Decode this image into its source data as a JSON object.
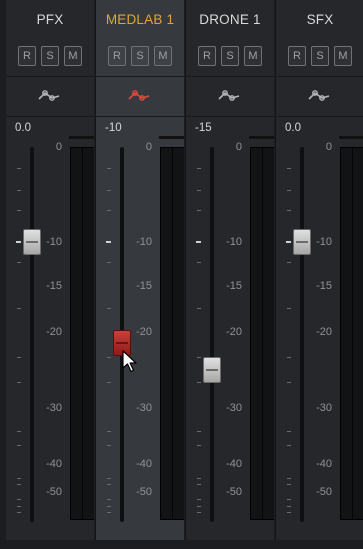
{
  "mixer": {
    "channels": [
      {
        "name": "PFX",
        "value": "0.0",
        "selected": false,
        "fader_db": -10,
        "knob": "gray",
        "eq_color": "#b4b6ba",
        "rsm": {
          "r": "R",
          "s": "S",
          "m": "M"
        }
      },
      {
        "name": "MEDLAB 1",
        "value": "-10",
        "selected": true,
        "fader_db": -21.5,
        "knob": "red",
        "eq_color": "#e04a3a",
        "rsm": {
          "r": "R",
          "s": "S",
          "m": "M"
        }
      },
      {
        "name": "DRONE 1",
        "value": "-15",
        "selected": false,
        "fader_db": -25,
        "knob": "gray",
        "eq_color": "#b4b6ba",
        "rsm": {
          "r": "R",
          "s": "S",
          "m": "M"
        }
      },
      {
        "name": "SFX",
        "value": "0.0",
        "selected": false,
        "fader_db": -10,
        "knob": "gray",
        "eq_color": "#b4b6ba",
        "rsm": {
          "r": "R",
          "s": "S",
          "m": "M"
        }
      }
    ],
    "scale": [
      {
        "db": 0,
        "label": "0"
      },
      {
        "db": -10,
        "label": "-10"
      },
      {
        "db": -15,
        "label": "-15"
      },
      {
        "db": -20,
        "label": "-20"
      },
      {
        "db": -30,
        "label": "-30"
      },
      {
        "db": -40,
        "label": "-40"
      },
      {
        "db": -50,
        "label": "-50"
      }
    ],
    "accent_color": "#e0a43a",
    "cursor_icon": "mouse-pointer-icon"
  }
}
